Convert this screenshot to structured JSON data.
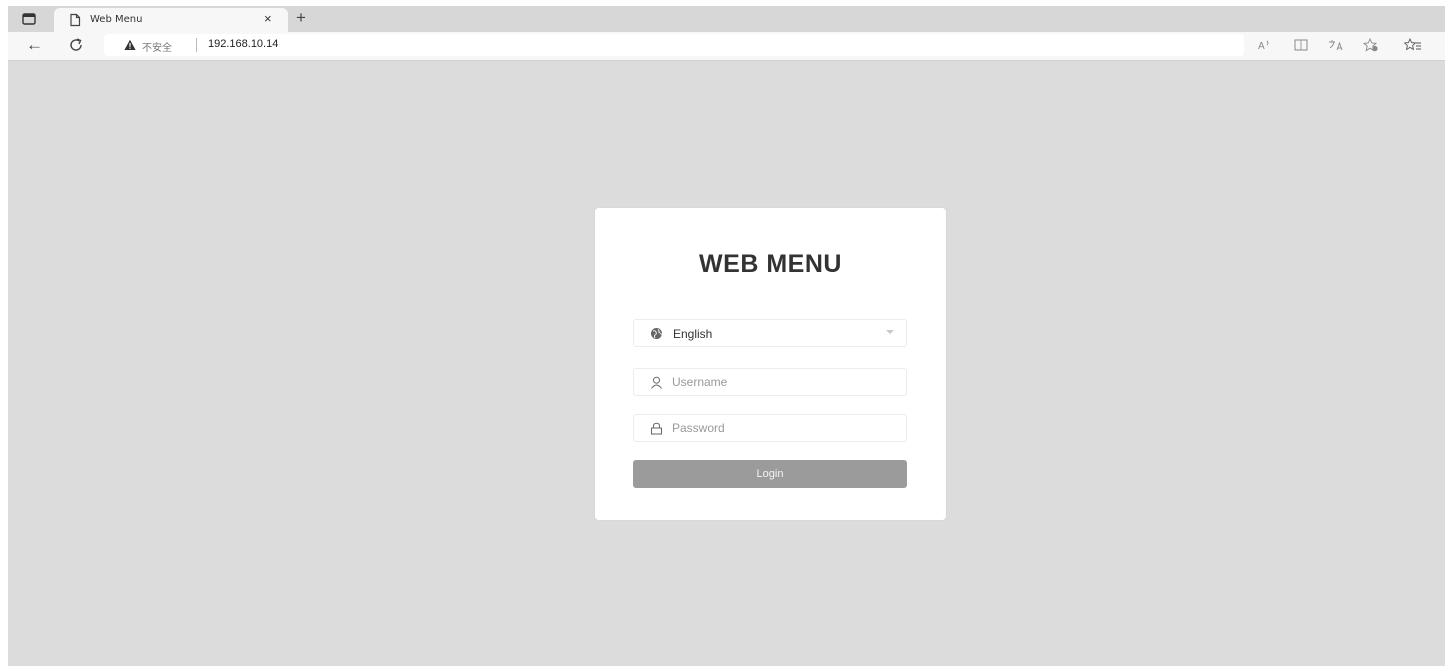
{
  "browser": {
    "tab": {
      "title": "Web Menu",
      "close_glyph": "×"
    },
    "new_tab_glyph": "+",
    "back_glyph": "←",
    "address": {
      "security_label": "不安全",
      "url": "192.168.10.14"
    },
    "toolbar_icons": [
      "read-aloud-icon",
      "immersive-reader-icon",
      "translate-icon",
      "favorites-add-icon",
      "favorites-icon"
    ]
  },
  "login": {
    "title": "WEB MENU",
    "language": {
      "selected": "English"
    },
    "username": {
      "placeholder": "Username",
      "value": ""
    },
    "password": {
      "placeholder": "Password",
      "value": ""
    },
    "login_label": "Login"
  },
  "colors": {
    "page_background": "#dcdcdc",
    "card_background": "#ffffff",
    "login_button": "#9b9b9b"
  }
}
